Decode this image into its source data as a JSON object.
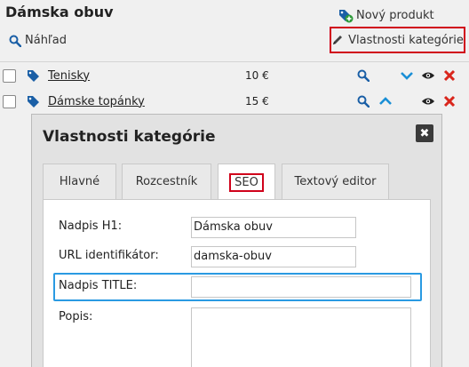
{
  "header": {
    "title": "Dámska obuv",
    "preview_label": "Náhľad",
    "new_product_label": "Nový produkt",
    "properties_label": "Vlastnosti kategórie"
  },
  "rows": [
    {
      "name": "Tenisky",
      "price": "10 €"
    },
    {
      "name": "Dámske topánky",
      "price": "15 €"
    }
  ],
  "modal": {
    "title": "Vlastnosti kategórie",
    "close": "✖",
    "tabs": [
      {
        "label": "Hlavné"
      },
      {
        "label": "Rozcestník"
      },
      {
        "label": "SEO"
      },
      {
        "label": "Textový editor"
      }
    ],
    "fields": {
      "h1_label": "Nadpis H1:",
      "h1_value": "Dámska obuv",
      "url_label": "URL identifikátor:",
      "url_value": "damska-obuv",
      "title_label": "Nadpis TITLE:",
      "title_value": "",
      "desc_label": "Popis:"
    }
  },
  "colors": {
    "red_outline": "#d0021b",
    "blue_highlight": "#2a9ae2",
    "icon_blue": "#1a5fa6",
    "delete_red": "#d9261c",
    "arrow_blue": "#1a8fd6"
  }
}
